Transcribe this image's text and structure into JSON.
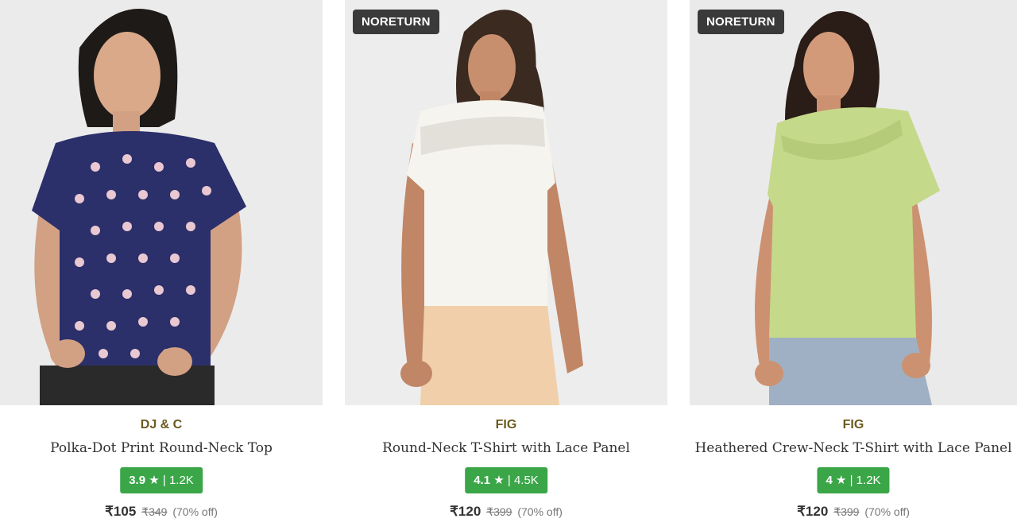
{
  "products": [
    {
      "tag": "",
      "brand": "DJ & C",
      "title": "Polka-Dot Print Round-Neck Top",
      "rating": "3.9",
      "star": "★",
      "separator": "|",
      "reviews": "1.2K",
      "price": "₹105",
      "mrp": "₹349",
      "discount": "(70% off)",
      "image_desc": "woman-in-navy-polka-dot-top"
    },
    {
      "tag": "NORETURN",
      "brand": "FIG",
      "title": "Round-Neck T-Shirt with Lace Panel",
      "rating": "4.1",
      "star": "★",
      "separator": "|",
      "reviews": "4.5K",
      "price": "₹120",
      "mrp": "₹399",
      "discount": "(70% off)",
      "image_desc": "woman-in-white-lace-tshirt"
    },
    {
      "tag": "NORETURN",
      "brand": "FIG",
      "title": "Heathered Crew-Neck T-Shirt with Lace Panel",
      "rating": "4",
      "star": "★",
      "separator": "|",
      "reviews": "1.2K",
      "price": "₹120",
      "mrp": "₹399",
      "discount": "(70% off)",
      "image_desc": "woman-in-lime-lace-tshirt"
    }
  ],
  "colors": {
    "rating_badge": "#3aa648",
    "brand_text": "#6b5a1e",
    "tag_bg": "#3a3a3a",
    "image_bg": "#ececec"
  }
}
